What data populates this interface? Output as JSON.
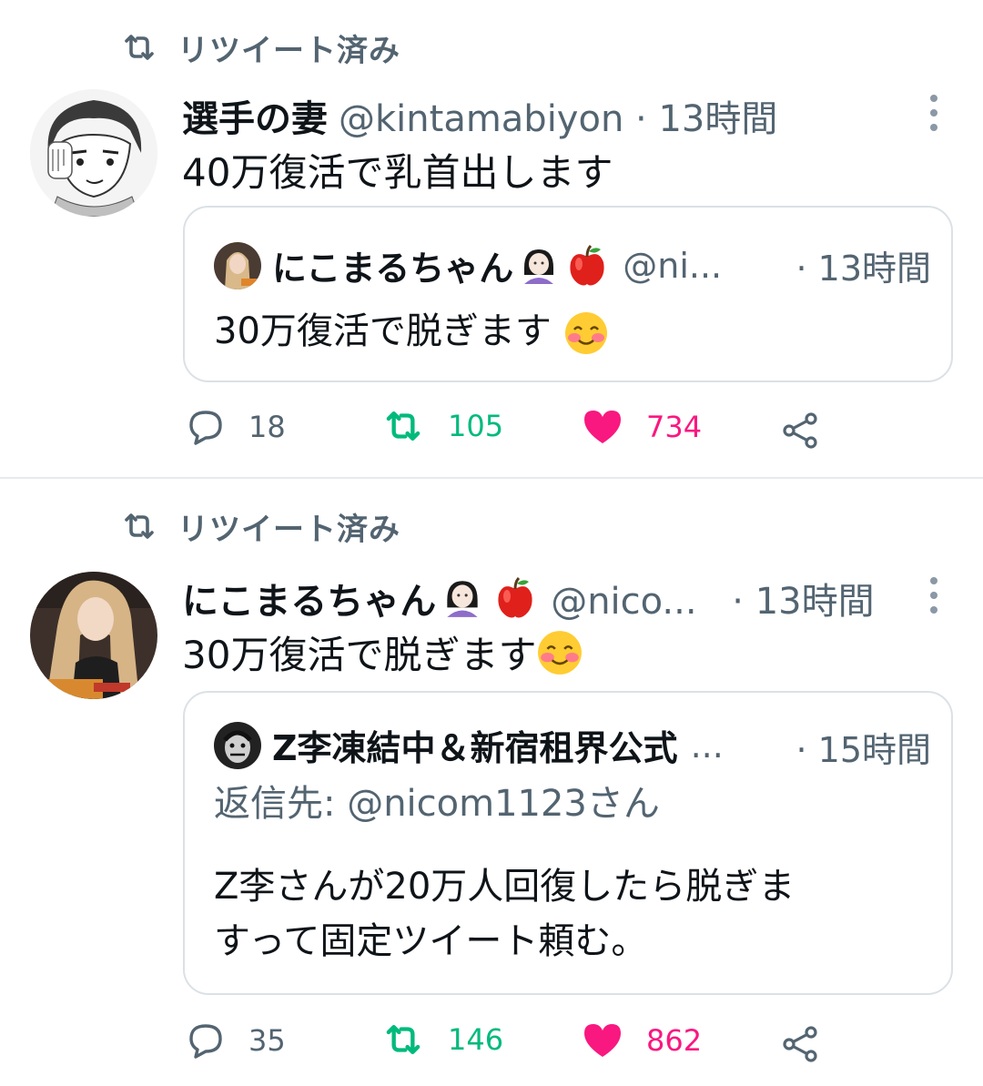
{
  "tweets": [
    {
      "retweet_label": "リツイート済み",
      "author_name": "選手の妻",
      "handle": "@kintamabiyon",
      "dot": " · ",
      "time": "13時間",
      "text": "40万復活で乳首出します",
      "quote": {
        "author_name": "にこまるちゃん",
        "handle": "@ni...",
        "time": "· 13時間",
        "text": "30万復活で脱ぎます"
      },
      "actions": {
        "replies": "18",
        "retweets": "105",
        "likes": "734"
      }
    },
    {
      "retweet_label": "リツイート済み",
      "author_name": "にこまるちゃん",
      "handle": "@nico...",
      "dot": " · ",
      "time": "13時間",
      "text": "30万復活で脱ぎます",
      "quote": {
        "author_name": "Z李凍結中＆新宿租界公式",
        "ellipsis": "...",
        "time": "· 15時間",
        "reply_to": "返信先: @nicom1123さん",
        "text_line1": "Z李さんが20万人回復したら脱ぎま",
        "text_line2": "すって固定ツイート頼む。"
      },
      "actions": {
        "replies": "35",
        "retweets": "146",
        "likes": "862"
      }
    }
  ],
  "colors": {
    "retweet_green": "#00ba7c",
    "like_pink": "#f91880",
    "muted": "#536471",
    "border": "#dbe1e5"
  },
  "icons": [
    "retweet-icon",
    "more-icon",
    "reply-icon",
    "heart-icon",
    "share-icon",
    "woman-emoji",
    "apple-emoji",
    "smiling-blush-emoji"
  ]
}
